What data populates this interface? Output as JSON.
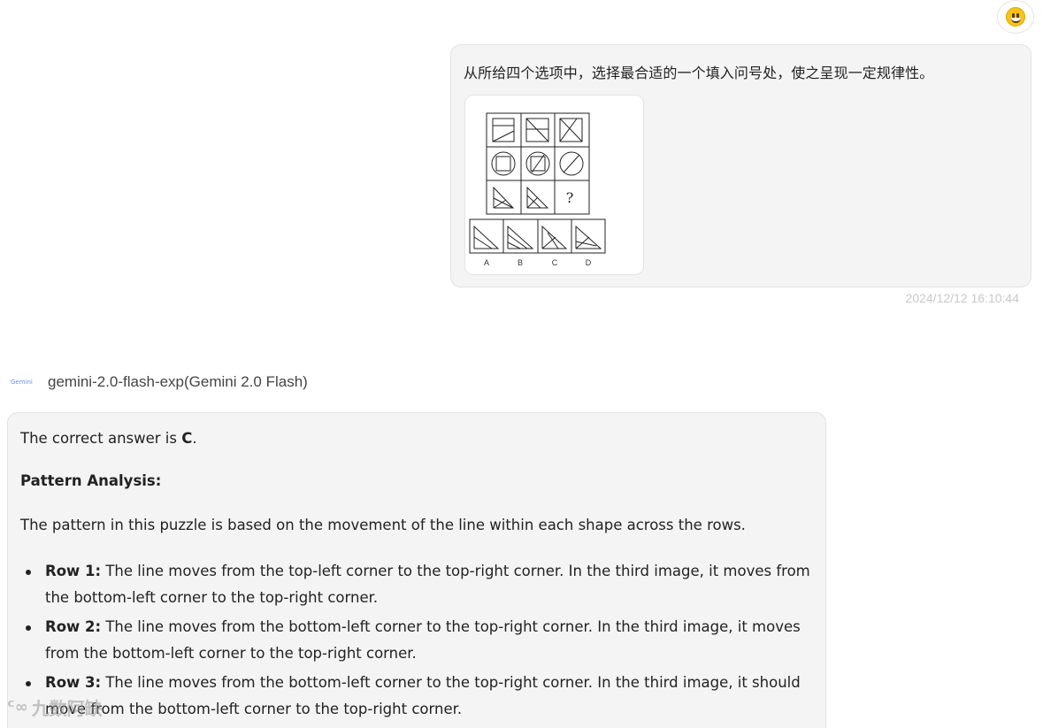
{
  "header": {
    "avatar_icon": "smiley-face-icon"
  },
  "user_message": {
    "text": "从所给四个选项中，选择最合适的一个填入问号处，使之呈现一定规律性。",
    "image": {
      "question_mark": "?",
      "option_labels": [
        "A",
        "B",
        "C",
        "D"
      ]
    },
    "timestamp": "2024/12/12 16:10:44"
  },
  "model": {
    "logo_text": "Gemini",
    "name": "gemini-2.0-flash-exp(Gemini 2.0 Flash)"
  },
  "answer": {
    "intro_prefix": "The correct answer is ",
    "intro_answer": "C",
    "intro_suffix": ".",
    "section_title": "Pattern Analysis:",
    "summary": "The pattern in this puzzle is based on the movement of the line within each shape across the rows.",
    "rows": [
      {
        "label": "Row 1:",
        "text": " The line moves from the top-left corner to the top-right corner. In the third image, it moves from the bottom-left corner to the top-right corner."
      },
      {
        "label": "Row 2:",
        "text": " The line moves from the bottom-left corner to the top-right corner. In the third image, it moves from the bottom-left corner to the top-right corner."
      },
      {
        "label": "Row 3:",
        "text": " The line moves from the bottom-left corner to the top-right corner. In the third image, it should move from the bottom-left corner to the top-right corner."
      }
    ]
  },
  "watermark": {
    "text": "九数阿缺"
  }
}
